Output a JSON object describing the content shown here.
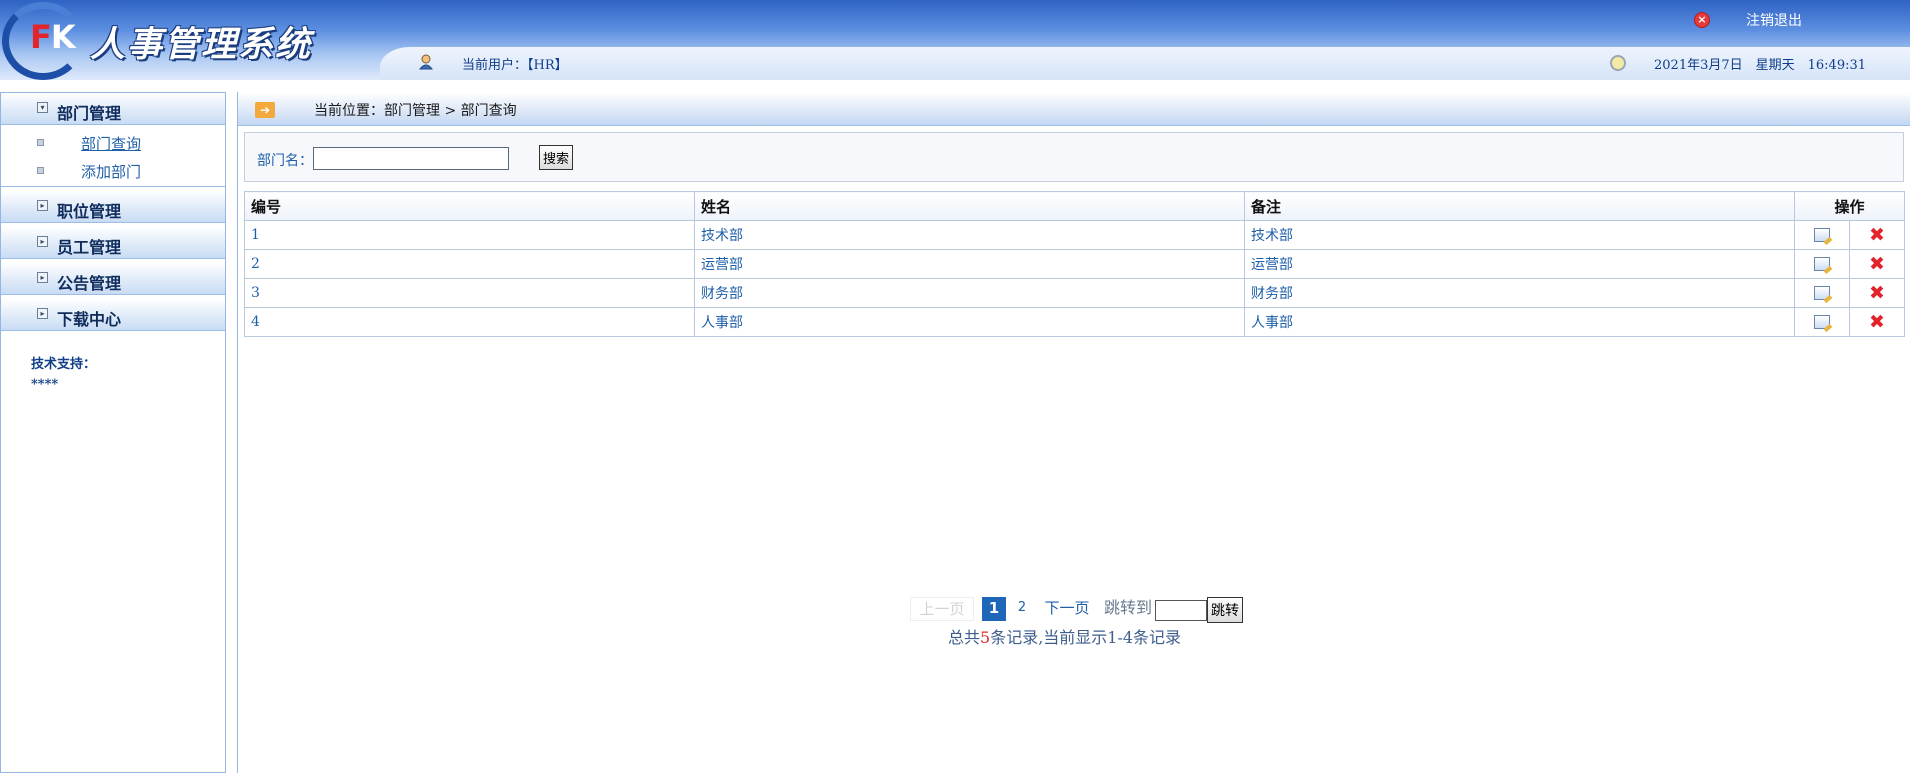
{
  "header": {
    "logo_f": "F",
    "logo_k": "K",
    "title": "人事管理系统",
    "current_user_label": "当前用户：【HR】",
    "logout_label": "注销退出",
    "date_text": "2021年3月7日　星期天　16:49:31"
  },
  "sidebar": {
    "menus": [
      {
        "label": "部门管理",
        "expanded": true,
        "items": [
          {
            "label": "部门查询",
            "active": true
          },
          {
            "label": "添加部门",
            "active": false
          }
        ]
      },
      {
        "label": "职位管理",
        "expanded": false
      },
      {
        "label": "员工管理",
        "expanded": false
      },
      {
        "label": "公告管理",
        "expanded": false
      },
      {
        "label": "下载中心",
        "expanded": false
      }
    ],
    "support_label": "技术支持：",
    "support_value": "****"
  },
  "breadcrumb": {
    "label": "当前位置：部门管理 > 部门查询"
  },
  "search": {
    "label": "部门名：",
    "value": "",
    "placeholder": "",
    "button_label": "搜索"
  },
  "table": {
    "headers": [
      "编号",
      "姓名",
      "备注",
      "操作"
    ],
    "rows": [
      {
        "id": "1",
        "name": "技术部",
        "remark": "技术部"
      },
      {
        "id": "2",
        "name": "运营部",
        "remark": "运营部"
      },
      {
        "id": "3",
        "name": "财务部",
        "remark": "财务部"
      },
      {
        "id": "4",
        "name": "人事部",
        "remark": "人事部"
      }
    ]
  },
  "pagination": {
    "prev_label": "上一页",
    "current_page": "1",
    "page_2": "2",
    "next_label": "下一页",
    "jump_label": "跳转到",
    "go_label": "跳转",
    "summary_prefix": "总共",
    "total": "5",
    "summary_suffix": "条记录,当前显示1-4条记录"
  },
  "colors": {
    "accent": "#1d66b8",
    "link": "#1f5fa8",
    "danger": "#e3232c"
  },
  "icons": {
    "user": "user-icon",
    "logout": "close-circle-icon",
    "clock": "clock-icon",
    "breadcrumb": "arrow-right-icon",
    "edit": "edit-icon",
    "delete": "delete-icon"
  }
}
